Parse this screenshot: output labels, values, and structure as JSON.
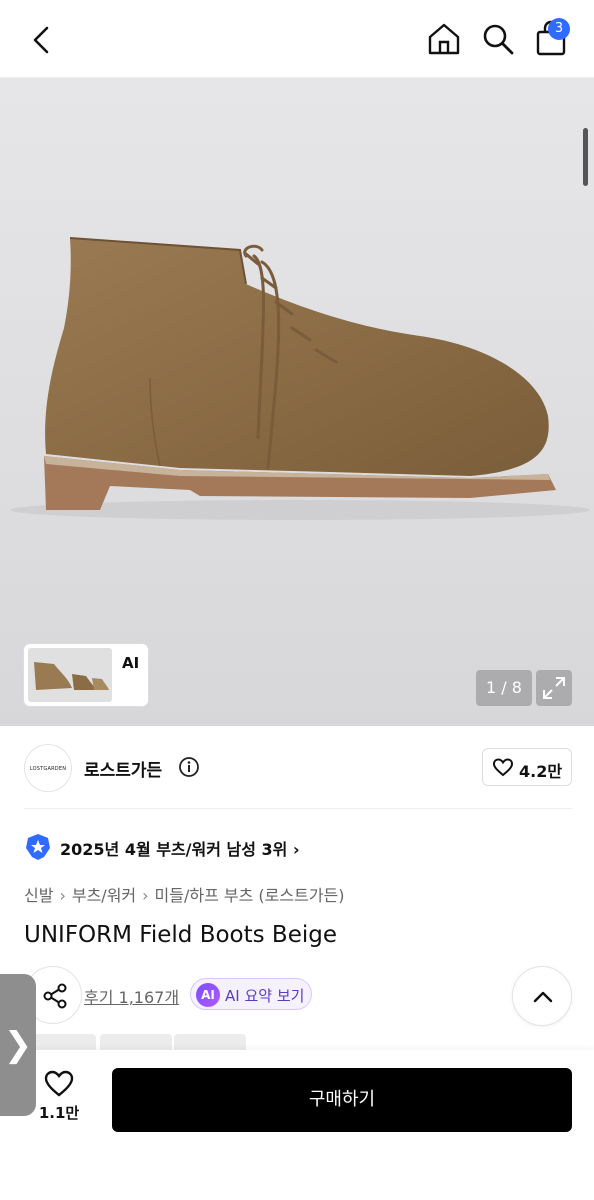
{
  "header": {
    "cart_count": "3"
  },
  "gallery": {
    "ai_label": "AI",
    "ai_arrow": "›",
    "counter": "1 / 8"
  },
  "brand": {
    "logo_text": "LOSTGARDEN",
    "name": "로스트가든",
    "likes": "4.2만"
  },
  "ranking": {
    "text": "2025년 4월 부츠/워커 남성 3위 ›"
  },
  "breadcrumb": [
    "신발",
    "부츠/워커",
    "미들/하프 부츠 (로스트가든)"
  ],
  "breadcrumb_sep": "›",
  "product": {
    "title": "UNIFORM Field Boots Beige"
  },
  "reviews": {
    "link_text": "후기 1,167개",
    "ai_badge": "AI",
    "ai_summary": "AI 요약 보기"
  },
  "side_handle": {
    "glyph": "❯"
  },
  "bottom_bar": {
    "wish_count": "1.1만",
    "buy_label": "구매하기"
  },
  "colors": {
    "accent": "#2f6bff",
    "ai_purple": "#7a4cff",
    "buy_bg": "#000000"
  }
}
